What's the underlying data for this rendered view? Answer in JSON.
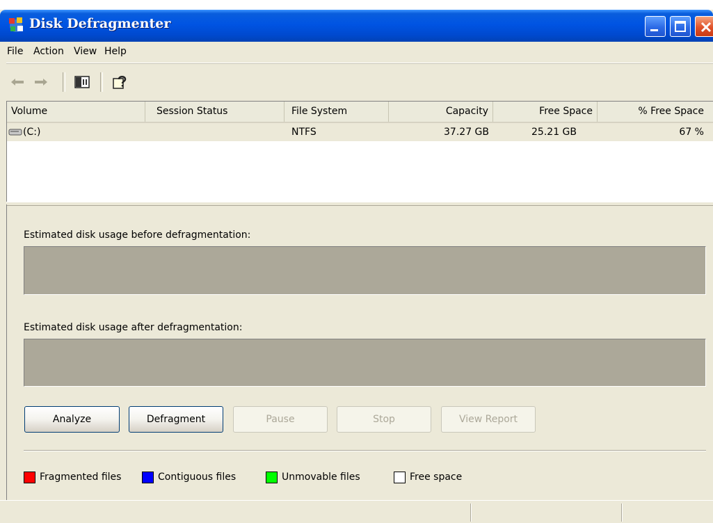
{
  "window": {
    "title": "Disk Defragmenter"
  },
  "menu": [
    "File",
    "Action",
    "View",
    "Help"
  ],
  "toolbar": [
    "back-arrow-icon",
    "forward-arrow-icon",
    "show-hide-console-tree-icon",
    "help-icon"
  ],
  "volume_list": {
    "columns": [
      "Volume",
      "Session Status",
      "File System",
      "Capacity",
      "Free Space",
      "% Free Space"
    ],
    "rows": [
      {
        "volume": "(C:)",
        "session_status": "",
        "file_system": "NTFS",
        "capacity": "37.27 GB",
        "free_space": "25.21 GB",
        "percent_free": "67 %"
      }
    ]
  },
  "analysis": {
    "before_label": "Estimated disk usage before defragmentation:",
    "after_label": "Estimated disk usage after defragmentation:"
  },
  "buttons": {
    "analyze": "Analyze",
    "defragment": "Defragment",
    "pause": "Pause",
    "stop": "Stop",
    "view_report": "View Report"
  },
  "legend": [
    {
      "label": "Fragmented files",
      "color": "#FF0000"
    },
    {
      "label": "Contiguous files",
      "color": "#0000FF"
    },
    {
      "label": "Unmovable files",
      "color": "#00FF00"
    },
    {
      "label": "Free space",
      "color": "#FFFFFF"
    }
  ],
  "colors": {
    "titlebar": "#0054E3",
    "window_face": "#ECE9D8",
    "usage_bar": "#ACA899"
  }
}
